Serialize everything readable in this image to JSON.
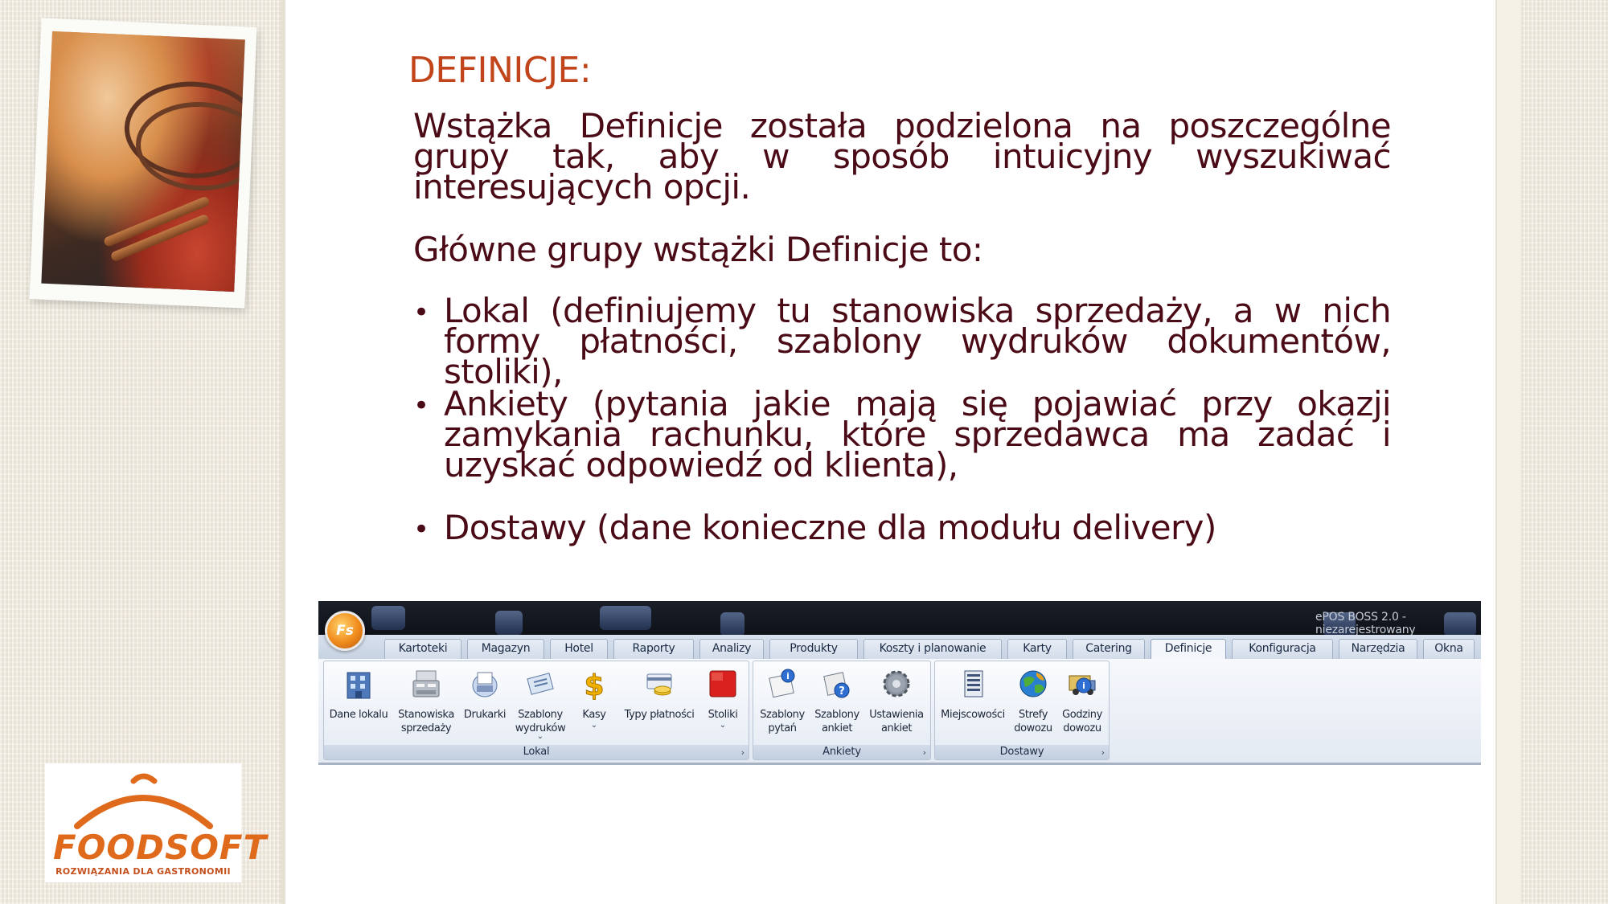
{
  "slide": {
    "title": "DEFINICJE:",
    "paragraph1": "Wstążka Definicje została podzielona na poszczególne grupy tak, aby w sposób intuicyjny wyszukiwać interesujących opcji.",
    "paragraph2": "Główne grupy wstążki Definicje to:",
    "bullets": [
      " Lokal (definiujemy tu stanowiska sprzedaży, a w nich formy płatności, szablony wydruków dokumentów, stoliki),",
      "Ankiety (pytania jakie mają się pojawiać przy okazji zamykania rachunku, które sprzedawca ma zadać i uzyskać odpowiedź od klienta),",
      "Dostawy (dane konieczne dla modułu delivery)"
    ],
    "bullet_symbol": "•"
  },
  "logo": {
    "name": "FOODSOFT",
    "tagline": "ROZWIĄZANIA DLA GASTRONOMII",
    "color": "#e06a1c"
  },
  "app": {
    "orb_label": "Fs",
    "title": "ePOS BOSS 2.0 - niezarejestrowany",
    "tabs": [
      "Kartoteki",
      "Magazyn",
      "Hotel",
      "Raporty",
      "Analizy",
      "Produkty",
      "Koszty i planowanie",
      "Karty",
      "Catering",
      "Definicje",
      "Konfiguracja",
      "Narzędzia",
      "Okna"
    ],
    "active_tab": "Definicje",
    "groups": [
      {
        "label": "Lokal",
        "buttons": [
          {
            "label": "Dane lokalu",
            "icon": "building-icon"
          },
          {
            "label": "Stanowiska\nsprzedaży",
            "icon": "cash-register-icon"
          },
          {
            "label": "Drukarki",
            "icon": "printer-icon"
          },
          {
            "label": "Szablony\nwydruków",
            "icon": "receipt-template-icon",
            "caret": "⌄"
          },
          {
            "label": "Kasy",
            "icon": "dollar-icon",
            "caret": "⌄"
          },
          {
            "label": "Typy płatności",
            "icon": "payment-types-icon"
          },
          {
            "label": "Stoliki",
            "icon": "table-icon",
            "caret": "⌄"
          }
        ]
      },
      {
        "label": "Ankiety",
        "buttons": [
          {
            "label": "Szablony\npytań",
            "icon": "question-template-icon"
          },
          {
            "label": "Szablony\nankiet",
            "icon": "survey-template-icon"
          },
          {
            "label": "Ustawienia\nankiet",
            "icon": "settings-gear-icon"
          }
        ]
      },
      {
        "label": "Dostawy",
        "buttons": [
          {
            "label": "Miejscowości",
            "icon": "locations-icon"
          },
          {
            "label": "Strefy\ndowozu",
            "icon": "globe-zones-icon"
          },
          {
            "label": "Godziny\ndowozu",
            "icon": "delivery-hours-icon"
          }
        ]
      }
    ],
    "group_expander": "›"
  },
  "colors": {
    "title": "#c2441b",
    "body_text": "#4a0a16",
    "ribbon_bg": "#dfe6ef"
  }
}
